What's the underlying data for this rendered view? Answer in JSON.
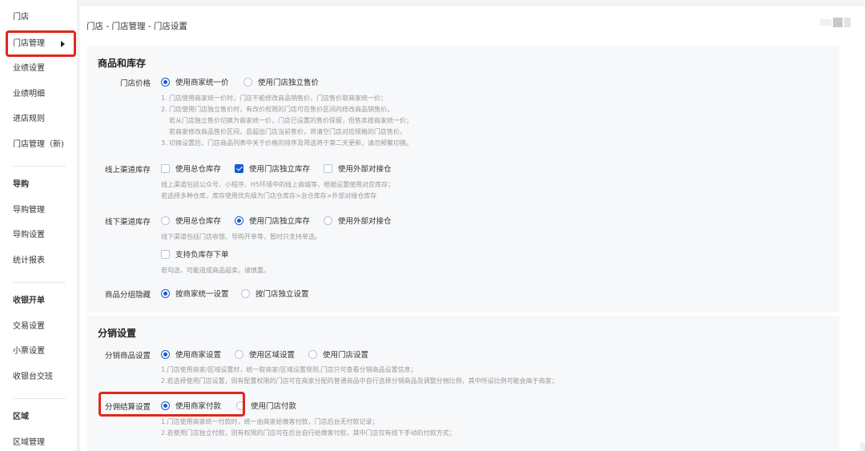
{
  "sidebar": {
    "items": [
      {
        "label": "门店"
      },
      {
        "label": "门店管理"
      },
      {
        "label": "业绩设置"
      },
      {
        "label": "业绩明细"
      },
      {
        "label": "进店规则"
      },
      {
        "label": "门店管理（新)"
      },
      {
        "label": "导购"
      },
      {
        "label": "导购管理"
      },
      {
        "label": "导购设置"
      },
      {
        "label": "统计报表"
      },
      {
        "label": "收银开单"
      },
      {
        "label": "交易设置"
      },
      {
        "label": "小票设置"
      },
      {
        "label": "收银台交班"
      },
      {
        "label": "区域"
      },
      {
        "label": "区域管理"
      }
    ]
  },
  "header": {
    "breadcrumb": "门店 - 门店管理 - 门店设置"
  },
  "inventory": {
    "title": "商品和库存",
    "price": {
      "label": "门店价格",
      "options": [
        "使用商家统一价",
        "使用门店独立售价"
      ],
      "notes": [
        "1. 门店使用商家统一价时，门店不能修改商品销售价，门店售价取商家统一价；",
        "2. 门店使用门店独立售价时，有改价权限的门店可在售价区间内修改商品销售价。",
        "若从门店独立售价切换为商家统一价，门店已设置的售价保留，但售卖按商家统一价；",
        "若商家修改商品售价区间，且超出门店当前售价，将清空门店对应规格的门店售价。",
        "3. 切换设置后，门店商品列表中关于价格的排序及筛选将于第二天更新，请勿频繁切换。"
      ]
    },
    "online": {
      "label": "线上渠道库存",
      "options": [
        "使用总仓库存",
        "使用门店独立库存",
        "使用外部对接仓"
      ],
      "notes": [
        "线上渠道包括公众号、小程序、H5环境中的线上商城等，根据设置使用对应库存；",
        "若选择多种仓库，库存使用优先级为门店仓库存>总仓库存>外部对接仓库存"
      ]
    },
    "offline": {
      "label": "线下渠道库存",
      "options": [
        "使用总仓库存",
        "使用门店独立库存",
        "使用外部对接仓"
      ],
      "note": "线下渠道包括门店收银、导购开单等，暂时只支持单选。",
      "negative_label": "支持负库存下单",
      "negative_note": "若勾选，可能造成商品超卖，请慎重。"
    },
    "group_hide": {
      "label": "商品分组隐藏",
      "options": [
        "按商家统一设置",
        "按门店独立设置"
      ]
    }
  },
  "distribution": {
    "title": "分销设置",
    "goods": {
      "label": "分销商品设置",
      "options": [
        "使用商家设置",
        "使用区域设置",
        "使用门店设置"
      ],
      "notes": [
        "1.门店使用商家/区域设置时，统一取商家/区域设置规则,门店只可查看分销商品设置信息；",
        "2.若选择使用门店设置，则有配置权限的门店可在商家分配的普通商品中自行选择分销商品及调整分佣比例，其中所设比例可能会高于商家；"
      ]
    },
    "settlement": {
      "label": "分佣结算设置",
      "options": [
        "使用商家付款",
        "使用门店付款"
      ],
      "notes": [
        "1.门店使用商家统一付款时，统一由商家给微客付款，门店后台无付款记录；",
        "2.若使用门店独立付款，则有权限的门店可在后台自行给微客付款，其中门店仅有线下手动的付款方式；"
      ]
    }
  },
  "colors": {
    "accent": "#155bd4",
    "highlight": "#e1261c"
  }
}
